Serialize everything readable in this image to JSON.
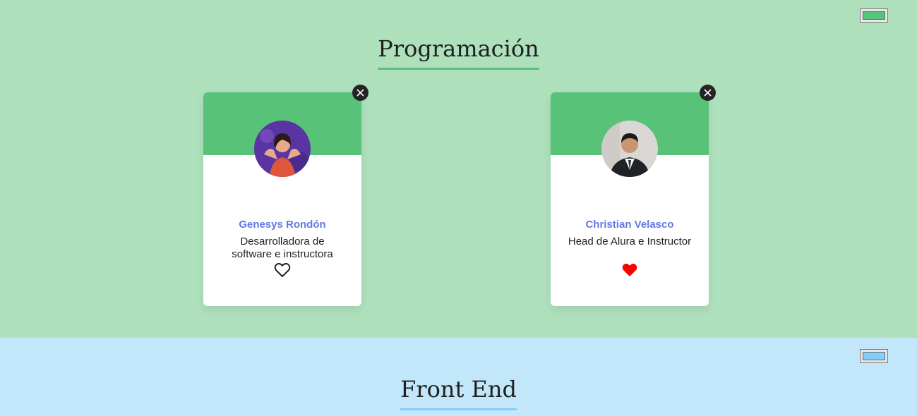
{
  "teams": [
    {
      "title": "Programación",
      "primary_color": "#57c278",
      "secondary_color": "#aee0bc",
      "color_picker_value": "#57c278",
      "members": [
        {
          "name": "Genesys Rondón",
          "role": "Desarrolladora de software e instructora",
          "favorite": false,
          "avatar_icon": "avatar-photo-icon"
        },
        {
          "name": "Christian Velasco",
          "role": "Head de Alura e Instructor",
          "favorite": true,
          "avatar_icon": "avatar-photo-icon"
        }
      ]
    },
    {
      "title": "Front End",
      "primary_color": "#82cffa",
      "secondary_color": "#c2e6fa",
      "color_picker_value": "#82cffa"
    }
  ],
  "icons": {
    "delete": "close-icon",
    "favorite_on": "heart-filled-icon",
    "favorite_off": "heart-outline-icon"
  },
  "colors": {
    "name_text": "#6278e6",
    "heart_favorite": "#ff0000",
    "delete_bg": "#242424"
  }
}
